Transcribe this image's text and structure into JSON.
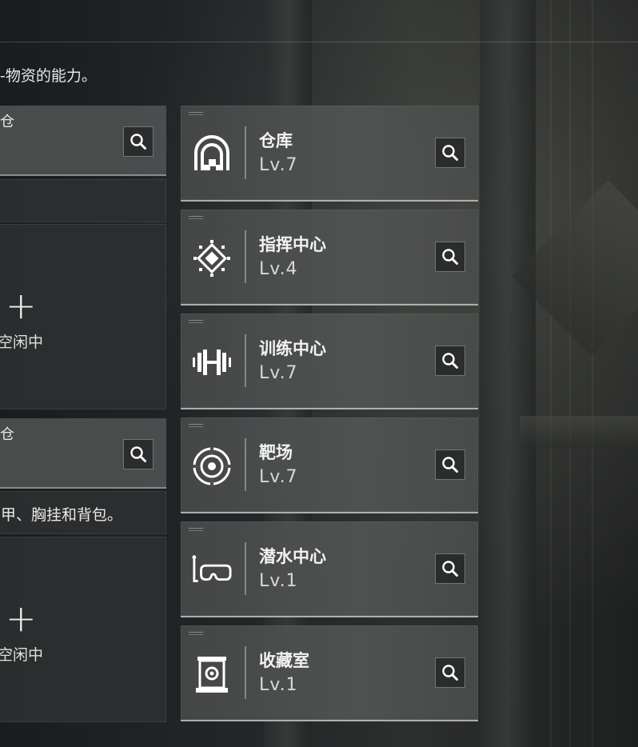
{
  "header": {
    "description_fragment": "-物资的能力。"
  },
  "left_panels": [
    {
      "header_text": "仓",
      "status": "空闲中",
      "add_symbol": "+",
      "status_text": "空闲中"
    },
    {
      "header_text": "仓",
      "description_fragment": "甲、胸挂和背包。",
      "add_symbol": "+",
      "status_text": "空闲中"
    }
  ],
  "facilities": [
    {
      "name": "仓库",
      "level": "Lv.7",
      "icon": "warehouse-icon"
    },
    {
      "name": "指挥中心",
      "level": "Lv.4",
      "icon": "command-center-icon"
    },
    {
      "name": "训练中心",
      "level": "Lv.7",
      "icon": "dumbbell-icon"
    },
    {
      "name": "靶场",
      "level": "Lv.7",
      "icon": "target-icon"
    },
    {
      "name": "潜水中心",
      "level": "Lv.1",
      "icon": "diving-mask-icon"
    },
    {
      "name": "收藏室",
      "level": "Lv.1",
      "icon": "display-case-icon"
    }
  ],
  "colors": {
    "card_bg": "#505252",
    "accent_line": "#ffffff",
    "text": "#e8e8e8"
  }
}
